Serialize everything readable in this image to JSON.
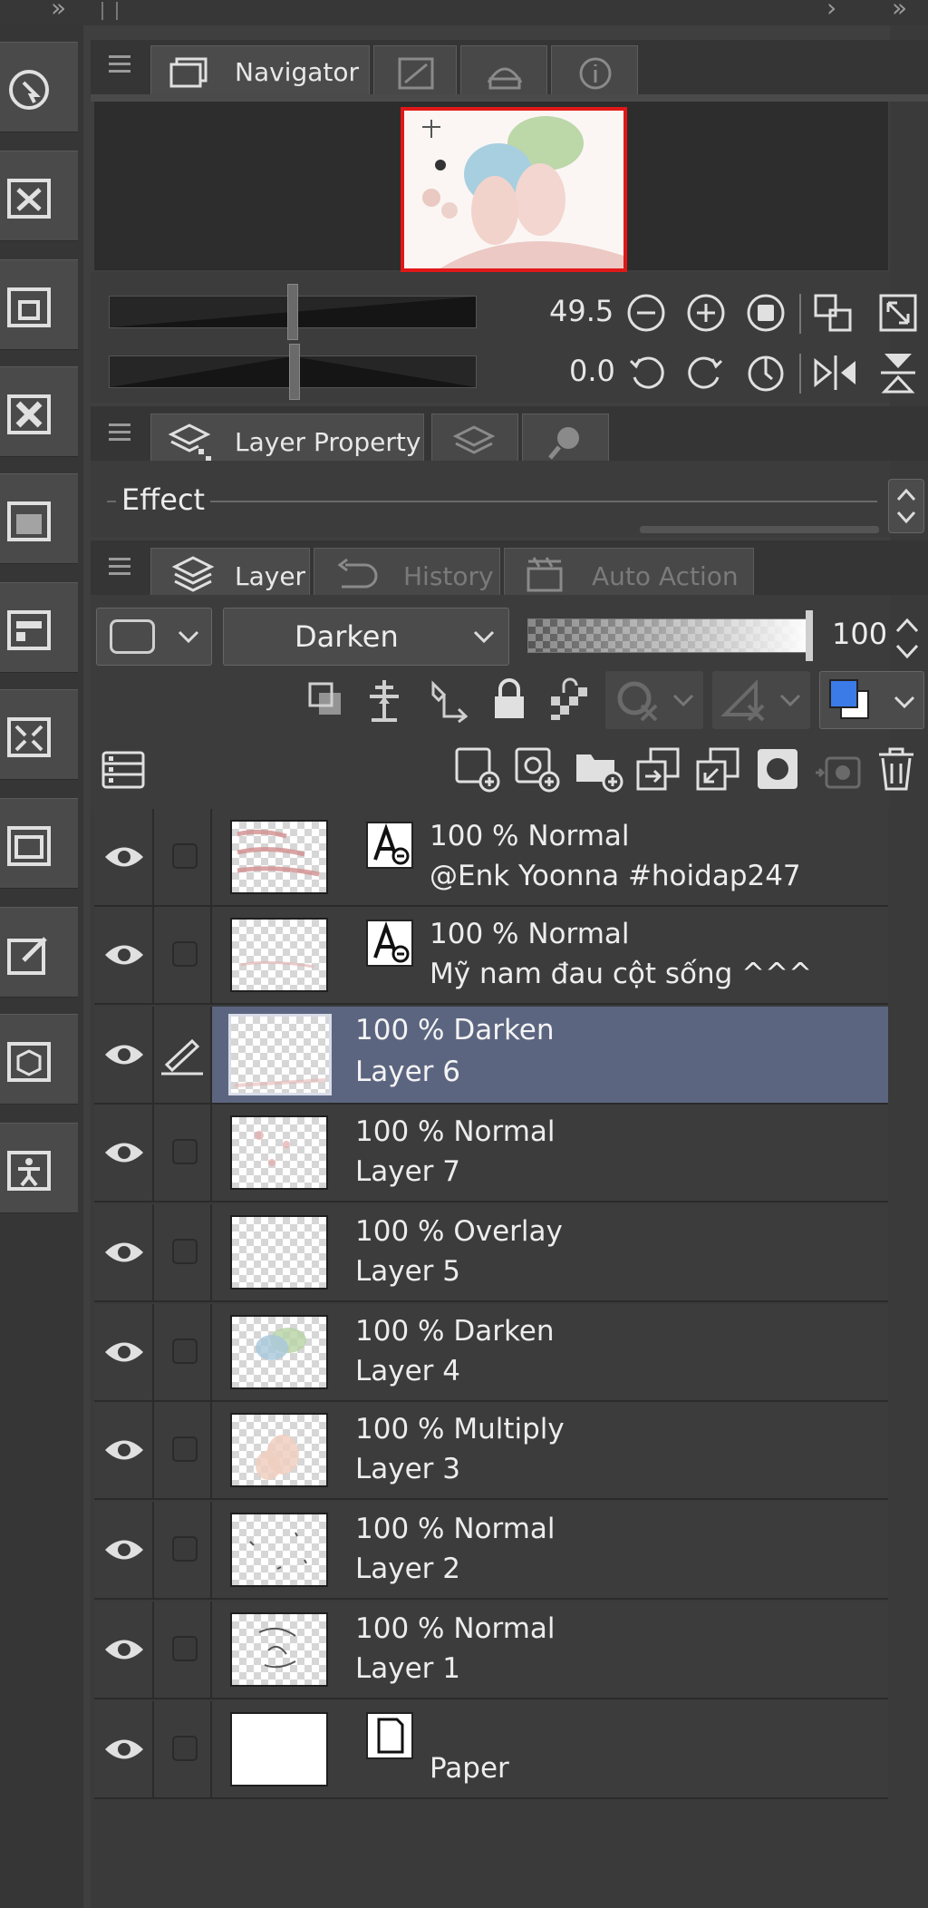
{
  "navigator_panel": {
    "tabs": [
      {
        "label": "Navigator",
        "icon": "navigator-icon"
      },
      {
        "label": "",
        "icon": "sub-view-icon"
      },
      {
        "label": "",
        "icon": "material-icon"
      },
      {
        "label": "",
        "icon": "info-icon"
      }
    ],
    "zoom_value": "49.5",
    "rotation_value": "0.0"
  },
  "layer_property_panel": {
    "tabs": [
      {
        "label": "Layer Property",
        "icon": "layer-property-icon"
      },
      {
        "label": "",
        "icon": "layer-search-icon"
      },
      {
        "label": "",
        "icon": "search-icon"
      }
    ],
    "effect_label": "Effect"
  },
  "layer_panel": {
    "tabs": [
      {
        "label": "Layer",
        "icon": "layer-stack-icon"
      },
      {
        "label": "History",
        "icon": "history-icon"
      },
      {
        "label": "Auto Action",
        "icon": "auto-action-icon"
      }
    ],
    "blend_mode": "Darken",
    "opacity": "100",
    "colors": {
      "main": "#3a7be8",
      "sub": "#ffffff"
    },
    "layers": [
      {
        "blend": "100 % Normal",
        "name": "@Enk Yoonna #hoidap247",
        "type": "text",
        "selected": false
      },
      {
        "blend": "100 % Normal",
        "name": "Mỹ nam đau cột sống ^^^",
        "type": "text",
        "selected": false
      },
      {
        "blend": "100 % Darken",
        "name": "Layer 6",
        "type": "raster",
        "selected": true
      },
      {
        "blend": "100 % Normal",
        "name": "Layer 7",
        "type": "raster",
        "selected": false
      },
      {
        "blend": "100 % Overlay",
        "name": "Layer 5",
        "type": "raster",
        "selected": false
      },
      {
        "blend": "100 % Darken",
        "name": "Layer 4",
        "type": "raster",
        "selected": false
      },
      {
        "blend": "100 % Multiply",
        "name": "Layer 3",
        "type": "raster",
        "selected": false
      },
      {
        "blend": "100 % Normal",
        "name": "Layer 2",
        "type": "raster",
        "selected": false
      },
      {
        "blend": "100 % Normal",
        "name": "Layer 1",
        "type": "raster",
        "selected": false
      },
      {
        "blend": "",
        "name": "Paper",
        "type": "paper",
        "selected": false
      }
    ]
  }
}
